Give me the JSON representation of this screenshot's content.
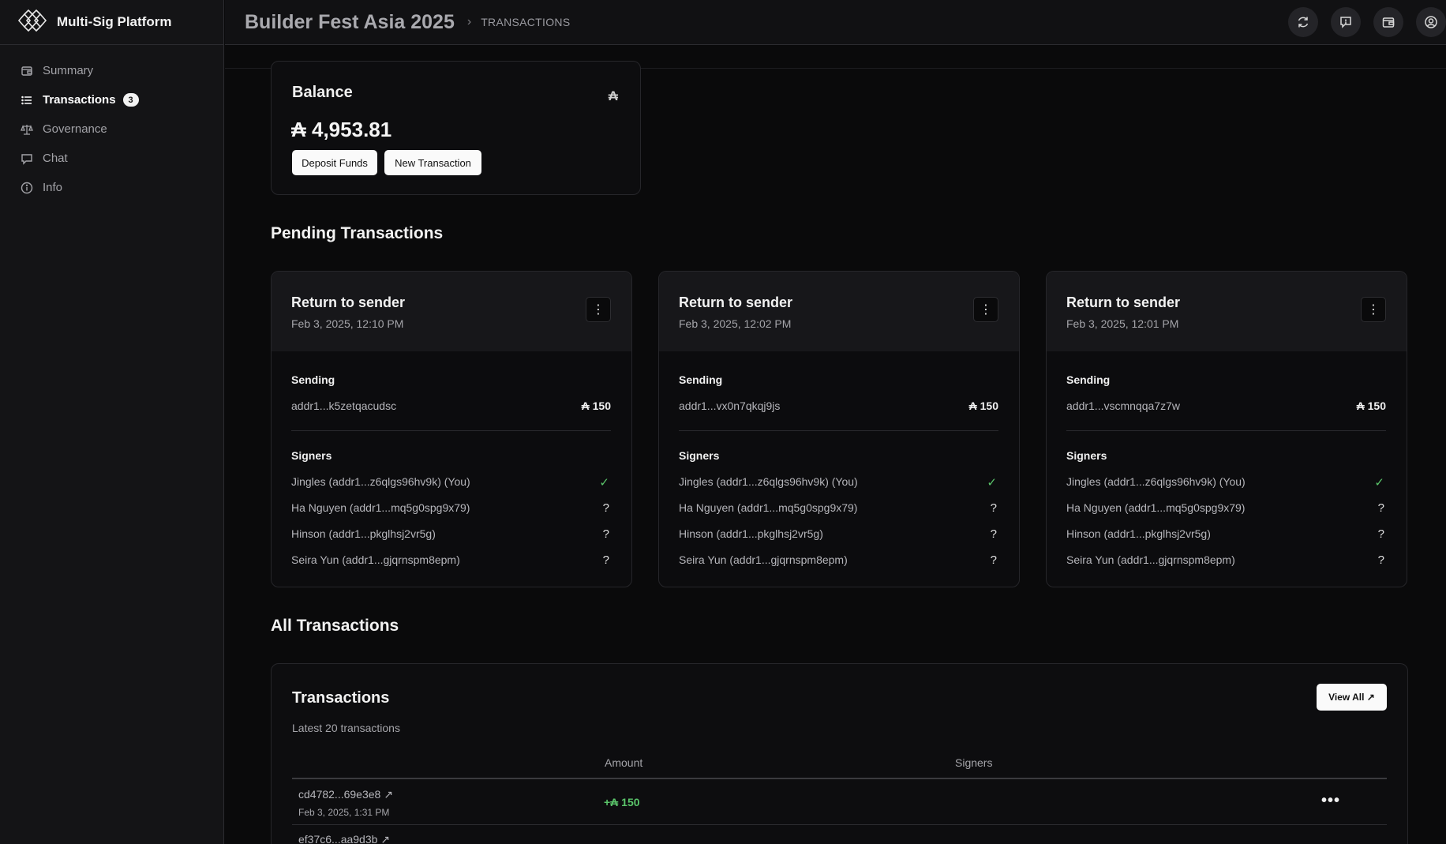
{
  "app": {
    "brand": "Multi-Sig Platform",
    "logo_icon": "multi-diamond-logo-icon"
  },
  "sidebar": {
    "items": [
      {
        "label": "Summary",
        "icon": "wallet-icon",
        "active": false
      },
      {
        "label": "Transactions",
        "icon": "list-icon",
        "active": true,
        "badge": "3"
      },
      {
        "label": "Governance",
        "icon": "scale-icon",
        "active": false
      },
      {
        "label": "Chat",
        "icon": "chat-icon",
        "active": false
      },
      {
        "label": "Info",
        "icon": "info-icon",
        "active": false
      }
    ]
  },
  "header": {
    "title": "Builder Fest Asia 2025",
    "chevron": "›",
    "crumb": "TRANSACTIONS",
    "icons": [
      "refresh-icon",
      "feedback-icon",
      "wallet-icon",
      "user-icon"
    ]
  },
  "balance": {
    "title": "Balance",
    "currency_symbol": "₳",
    "value": "₳ 4,953.81",
    "deposit_label": "Deposit Funds",
    "new_tx_label": "New Transaction"
  },
  "pending": {
    "title": "Pending Transactions",
    "sending_label": "Sending",
    "signers_label": "Signers",
    "menu_glyph": "⋮",
    "cards": [
      {
        "title": "Return to sender",
        "date": "Feb 3, 2025, 12:10 PM",
        "address": "addr1...k5zetqacudsc",
        "amount": "₳ 150",
        "signers": [
          {
            "name": "Jingles (addr1...z6qlgs96hv9k) (You)",
            "status": "✓"
          },
          {
            "name": "Ha Nguyen (addr1...mq5g0spg9x79)",
            "status": "?"
          },
          {
            "name": "Hinson (addr1...pkglhsj2vr5g)",
            "status": "?"
          },
          {
            "name": "Seira Yun (addr1...gjqrnspm8epm)",
            "status": "?"
          }
        ]
      },
      {
        "title": "Return to sender",
        "date": "Feb 3, 2025, 12:02 PM",
        "address": "addr1...vx0n7qkqj9js",
        "amount": "₳ 150",
        "signers": [
          {
            "name": "Jingles (addr1...z6qlgs96hv9k) (You)",
            "status": "✓"
          },
          {
            "name": "Ha Nguyen (addr1...mq5g0spg9x79)",
            "status": "?"
          },
          {
            "name": "Hinson (addr1...pkglhsj2vr5g)",
            "status": "?"
          },
          {
            "name": "Seira Yun (addr1...gjqrnspm8epm)",
            "status": "?"
          }
        ]
      },
      {
        "title": "Return to sender",
        "date": "Feb 3, 2025, 12:01 PM",
        "address": "addr1...vscmnqqa7z7w",
        "amount": "₳ 150",
        "signers": [
          {
            "name": "Jingles (addr1...z6qlgs96hv9k) (You)",
            "status": "✓"
          },
          {
            "name": "Ha Nguyen (addr1...mq5g0spg9x79)",
            "status": "?"
          },
          {
            "name": "Hinson (addr1...pkglhsj2vr5g)",
            "status": "?"
          },
          {
            "name": "Seira Yun (addr1...gjqrnspm8epm)",
            "status": "?"
          }
        ]
      }
    ]
  },
  "all_tx": {
    "section_title": "All Transactions",
    "card_title": "Transactions",
    "subtitle": "Latest 20 transactions",
    "view_all": "View All ↗",
    "columns": [
      "Amount",
      "Signers"
    ],
    "rows": [
      {
        "hash": "cd4782...69e3e8 ↗",
        "date": "Feb 3, 2025, 1:31 PM",
        "amount": "+₳ 150",
        "menu": "•••"
      },
      {
        "hash": "ef37c6...aa9d3b ↗",
        "date": "",
        "amount": "",
        "menu": ""
      }
    ]
  },
  "colors": {
    "accent_green": "#5ac46a",
    "background": "#0a0a0b",
    "sidebar": "#141416"
  }
}
